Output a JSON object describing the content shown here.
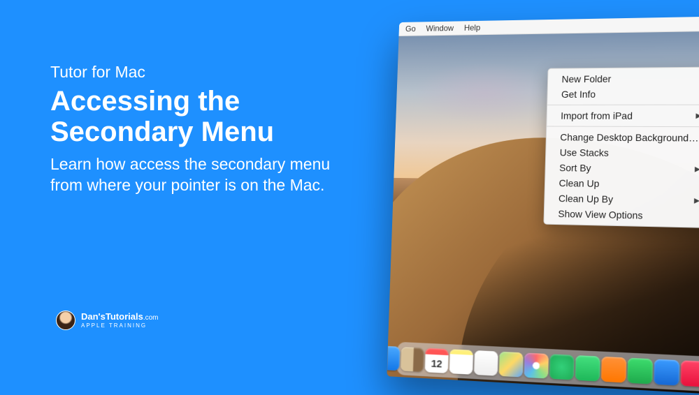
{
  "tutorial": {
    "subtitle": "Tutor for Mac",
    "title": "Accessing the Secondary Menu",
    "description": "Learn how access the secondary menu from where your pointer is on the Mac."
  },
  "branding": {
    "name": "Dan'sTutorials",
    "domain": ".com",
    "tagline": "APPLE TRAINING"
  },
  "menubar": {
    "items": [
      "Go",
      "Window",
      "Help"
    ]
  },
  "context_menu": {
    "groups": [
      [
        {
          "label": "New Folder",
          "arrow": false
        },
        {
          "label": "Get Info",
          "arrow": false
        }
      ],
      [
        {
          "label": "Import from iPad",
          "arrow": true
        }
      ],
      [
        {
          "label": "Change Desktop Background…",
          "arrow": false
        },
        {
          "label": "Use Stacks",
          "arrow": false
        },
        {
          "label": "Sort By",
          "arrow": true
        },
        {
          "label": "Clean Up",
          "arrow": false
        },
        {
          "label": "Clean Up By",
          "arrow": true
        },
        {
          "label": "Show View Options",
          "arrow": false
        }
      ]
    ]
  },
  "dock": {
    "icons": [
      {
        "name": "finder-icon",
        "bg": "linear-gradient(180deg,#3fb0ff,#0d66d0)"
      },
      {
        "name": "safari-icon",
        "bg": "radial-gradient(circle,#fff 30%,#1d9bf0 32%)"
      },
      {
        "name": "launchpad-icon",
        "bg": "linear-gradient(180deg,#9aa2ab,#6d7680)"
      },
      {
        "name": "mail-icon",
        "bg": "linear-gradient(180deg,#4aa8ff,#1378e8)"
      },
      {
        "name": "contacts-icon",
        "bg": "linear-gradient(90deg,#d9c29a 55%,#8a6a48 55%)"
      },
      {
        "name": "calendar-icon",
        "bg": "linear-gradient(180deg,#fff 70%,#fff),linear-gradient(180deg,#ff4d4d,#ff4d4d)",
        "text": "12"
      },
      {
        "name": "notes-icon",
        "bg": "linear-gradient(180deg,#fff07a 20%,#fff 20%)"
      },
      {
        "name": "reminders-icon",
        "bg": "linear-gradient(180deg,#fff,#eee)"
      },
      {
        "name": "maps-icon",
        "bg": "linear-gradient(135deg,#9be48b,#ffd966 50%,#5ca9ff)"
      },
      {
        "name": "photos-icon",
        "bg": "radial-gradient(circle,#fff 20%,transparent 21%),conic-gradient(#ff6b6b,#ffd166,#89e089,#5bc0eb,#9b7ede,#ff6b6b)"
      },
      {
        "name": "messages-icon",
        "bg": "radial-gradient(circle,#33d17a,#1fab55)"
      },
      {
        "name": "facetime-icon",
        "bg": "linear-gradient(180deg,#44e07e,#1fb85a)"
      },
      {
        "name": "pages-icon",
        "bg": "linear-gradient(180deg,#ff9138,#ff7700)"
      },
      {
        "name": "numbers-icon",
        "bg": "linear-gradient(180deg,#3ddc6e,#1faa4c)"
      },
      {
        "name": "keynote-icon",
        "bg": "linear-gradient(180deg,#3a9bff,#1668d4)"
      },
      {
        "name": "news-icon",
        "bg": "linear-gradient(180deg,#ff4466,#e8113c)"
      },
      {
        "name": "stocks-icon",
        "bg": "linear-gradient(180deg,#2b2b2b,#000)"
      },
      {
        "name": "blocked-icon",
        "bg": "radial-gradient(circle,#fff 30%,#cc2020 32%)"
      },
      {
        "name": "itunes-icon",
        "bg": "radial-gradient(circle,#fff 25%,transparent 26%),linear-gradient(135deg,#ff5fc3,#8a5cff,#4ac4ff)"
      },
      {
        "name": "appstore-icon",
        "bg": "radial-gradient(circle,#fff 20%,transparent 22%),linear-gradient(180deg,#34b9ff,#1b75ea)"
      }
    ]
  }
}
